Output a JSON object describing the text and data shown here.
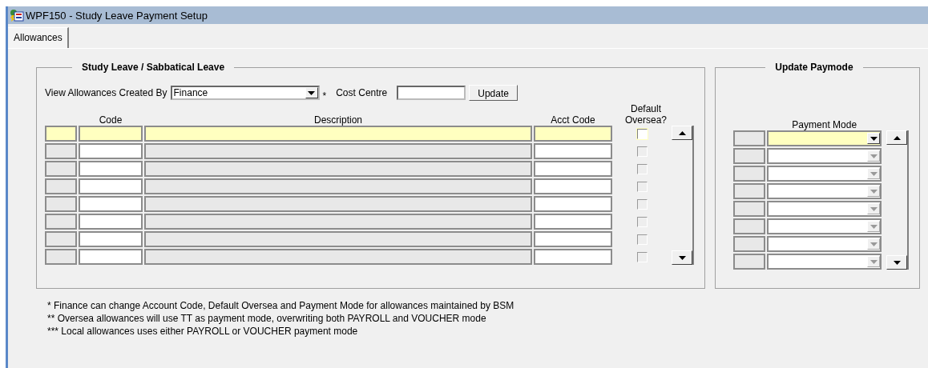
{
  "window": {
    "title": "WPF150 - Study Leave Payment Setup"
  },
  "tabs": [
    {
      "label": "Allowances",
      "selected": true
    }
  ],
  "allowances": {
    "title": "Study Leave / Sabbatical Leave",
    "created_by_label": "View Allowances Created By",
    "created_by_value": "Finance",
    "created_by_mark": "*",
    "cost_centre_label": "Cost Centre",
    "update_button": "Update",
    "columns": {
      "code": "Code",
      "description": "Description",
      "acct_code": "Acct Code",
      "oversea_1": "Default",
      "oversea_2": "Oversea?"
    },
    "rows": [
      {
        "current": true,
        "checked": false
      },
      {
        "current": false,
        "checked": false
      },
      {
        "current": false,
        "checked": false
      },
      {
        "current": false,
        "checked": false
      },
      {
        "current": false,
        "checked": false
      },
      {
        "current": false,
        "checked": false
      },
      {
        "current": false,
        "checked": false
      },
      {
        "current": false,
        "checked": false
      }
    ]
  },
  "paymode": {
    "title": "Update Paymode",
    "column": "Payment Mode",
    "rows": [
      {
        "current": true
      },
      {
        "current": false
      },
      {
        "current": false
      },
      {
        "current": false
      },
      {
        "current": false
      },
      {
        "current": false
      },
      {
        "current": false
      },
      {
        "current": false
      }
    ]
  },
  "notes": [
    "*  Finance can change Account Code, Default Oversea and Payment Mode for allowances maintained by BSM",
    "**  Oversea allowances will use TT as payment mode, overwriting both PAYROLL and VOUCHER mode",
    "*** Local allowances uses either PAYROLL or VOUCHER payment mode"
  ]
}
